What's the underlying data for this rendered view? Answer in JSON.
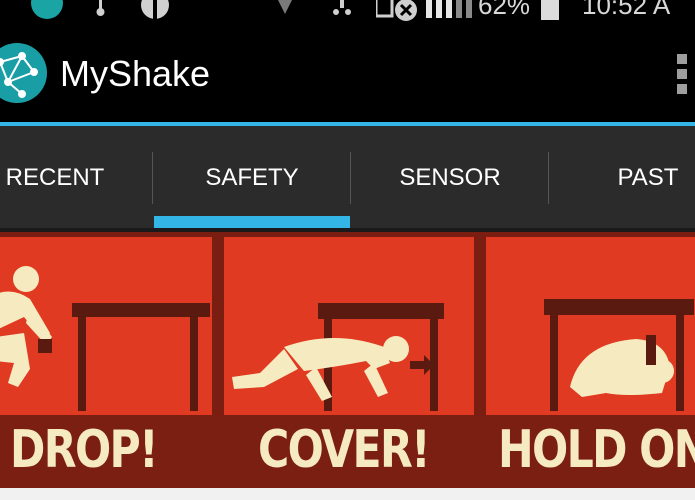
{
  "status_bar": {
    "battery_percent_text": "62%",
    "time_text": "10:52 A",
    "icons": [
      "app-icon",
      "usb-icon",
      "globe-icon",
      "signal-icon",
      "download-icon",
      "mute-icon",
      "cell-signal-icon",
      "battery-icon"
    ]
  },
  "action_bar": {
    "title": "MyShake",
    "logo_icon": "network-globe-icon",
    "menu_icon": "overflow-menu-icon"
  },
  "tabs": [
    {
      "label": "RECENT",
      "selected": false
    },
    {
      "label": "SAFETY",
      "selected": true
    },
    {
      "label": "SENSOR",
      "selected": false
    },
    {
      "label": "PAST",
      "selected": false
    }
  ],
  "safety": {
    "steps": [
      {
        "caption": "DROP!",
        "icon": "person-dropping-icon"
      },
      {
        "caption": "COVER!",
        "icon": "person-crawling-under-table-icon"
      },
      {
        "caption": "HOLD ON",
        "icon": "person-holding-on-icon"
      }
    ]
  },
  "colors": {
    "accent": "#33b5e5",
    "poster_red": "#e13a22",
    "poster_dark": "#7c1f13",
    "figure_cream": "#f6ebc0",
    "table_dark": "#5a1a10"
  }
}
